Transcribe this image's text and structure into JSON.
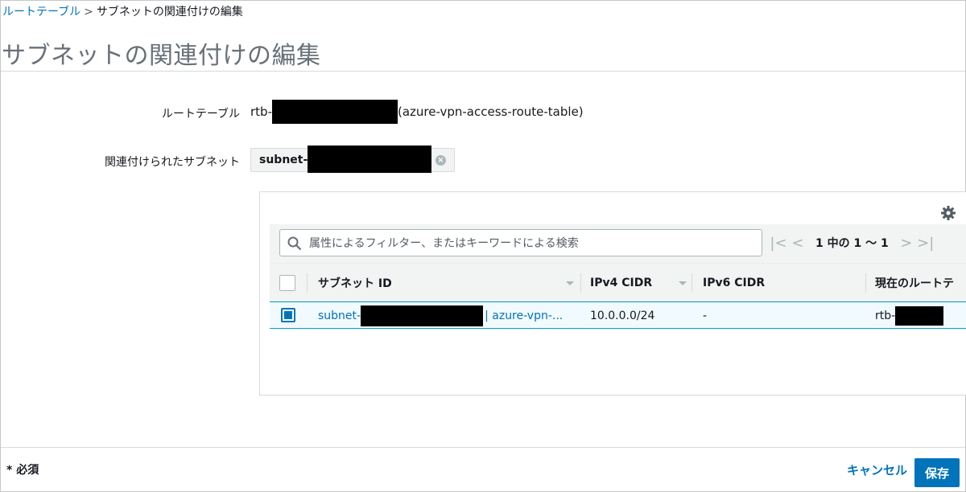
{
  "breadcrumb": {
    "parent": "ルートテーブル",
    "separator": ">",
    "current": "サブネットの関連付けの編集"
  },
  "page_title": "サブネットの関連付けの編集",
  "form": {
    "route_table_label": "ルートテーブル",
    "route_table_prefix": "rtb-",
    "route_table_name": "(azure-vpn-access-route-table)",
    "associated_subnets_label": "関連付けられたサブネット",
    "subnet_token_prefix": "subnet-"
  },
  "table": {
    "search_placeholder": "属性によるフィルター、またはキーワードによる検索",
    "pagination_text": "1 中の 1 ～ 1",
    "columns": [
      "サブネット ID",
      "IPv4 CIDR",
      "IPv6 CIDR",
      "現在のルートテ"
    ],
    "rows": [
      {
        "subnet_prefix": "subnet-",
        "subnet_suffix": "| azure-vpn-...",
        "ipv4_cidr": "10.0.0.0/24",
        "ipv6_cidr": "-",
        "current_route_prefix": "rtb-",
        "selected": true
      }
    ]
  },
  "footer": {
    "required_note": "* 必須",
    "cancel_label": "キャンセル",
    "save_label": "保存"
  },
  "colors": {
    "accent": "#0073bb",
    "title": "#687078",
    "header_bg": "#f2f3f3",
    "selected_row_bg": "#f1faff"
  },
  "icons": [
    "search-icon",
    "gear-icon",
    "first-page-icon",
    "prev-page-icon",
    "next-page-icon",
    "last-page-icon",
    "token-remove-icon",
    "sort-icon"
  ]
}
